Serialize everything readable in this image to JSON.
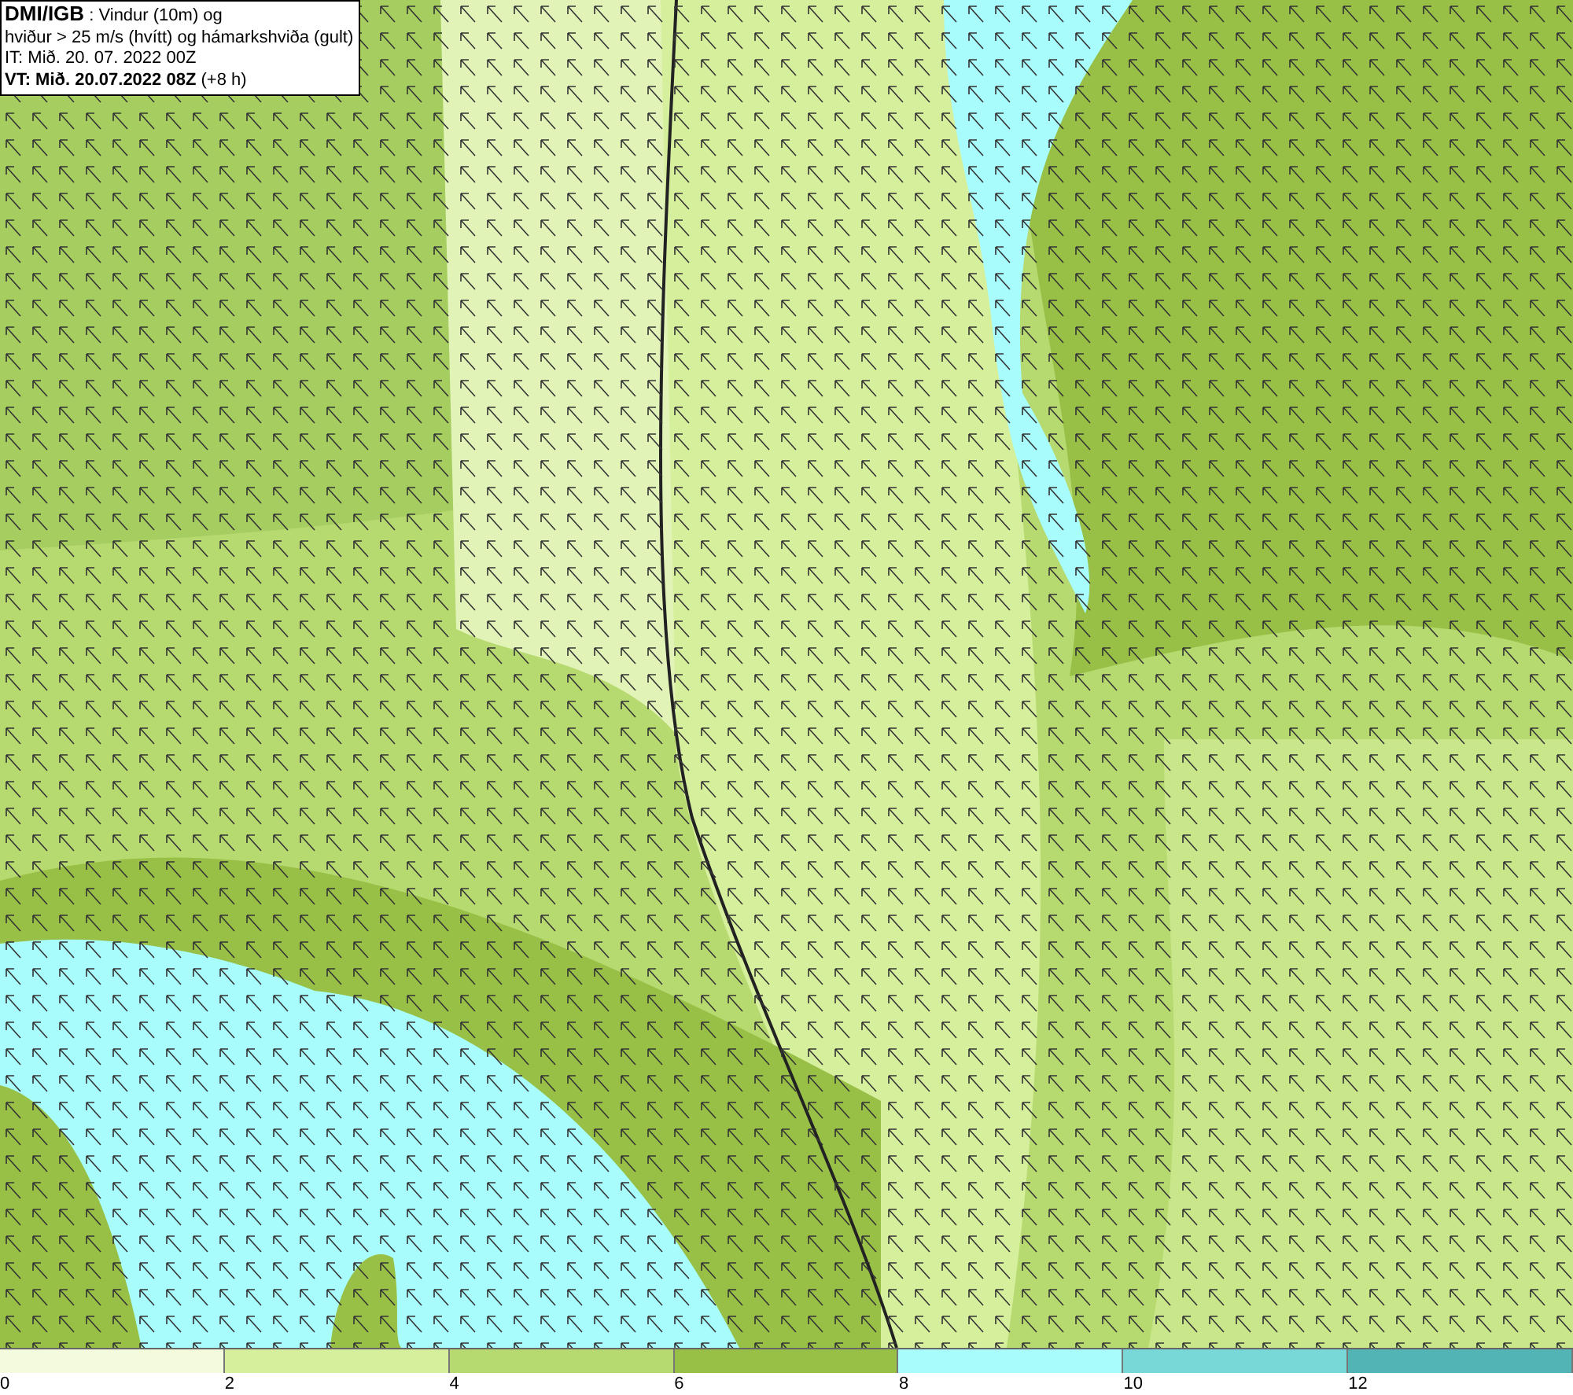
{
  "header": {
    "lines": [
      "**DMI/IGB** : Vindur (10m) og",
      "hviður > 25 m/s (hvítt) og hámarkshviða (gult)",
      "IT: Mið. 20. 07. 2022 00Z",
      "**VT: Mið. 20.07.2022 08Z** (+8 h)"
    ]
  },
  "legend": {
    "bins": [
      {
        "color": "#f4fbdc"
      },
      {
        "color": "#d6ef9c"
      },
      {
        "color": "#b6d970"
      },
      {
        "color": "#98c046"
      },
      {
        "color": "#a8fcfc"
      },
      {
        "color": "#78d8d8"
      },
      {
        "color": "#52b4b4"
      }
    ],
    "ticks": [
      "0",
      "2",
      "4",
      "6",
      "8",
      "10",
      "12"
    ]
  }
}
